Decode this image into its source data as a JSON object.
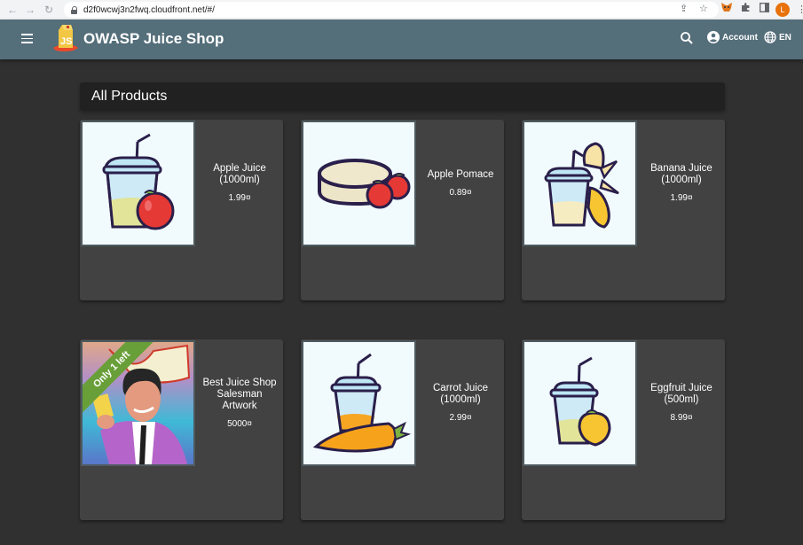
{
  "browser": {
    "url": "d2f0wcwj3n2fwq.cloudfront.net/#/",
    "profile_initial": "L",
    "icons": [
      "back-icon",
      "forward-icon",
      "reload-icon",
      "lock-icon",
      "share-icon",
      "star-icon",
      "metamask-extension-icon",
      "extensions-puzzle-icon",
      "sidepanel-icon",
      "profile-avatar",
      "more-menu-icon"
    ]
  },
  "toolbar": {
    "app_title": "OWASP Juice Shop",
    "account_label": "Account",
    "language_label": "EN",
    "color": "#546e7a"
  },
  "main": {
    "section_title": "All Products",
    "products": [
      {
        "name": "Apple Juice (1000ml)",
        "price": "1.99¤",
        "image": "apple-juice",
        "badge": null
      },
      {
        "name": "Apple Pomace",
        "price": "0.89¤",
        "image": "apple-pomace",
        "badge": null
      },
      {
        "name": "Banana Juice (1000ml)",
        "price": "1.99¤",
        "image": "banana-juice",
        "badge": null
      },
      {
        "name": "Best Juice Shop Salesman Artwork",
        "price": "5000¤",
        "image": "salesman-artwork",
        "badge": "Only 1 left"
      },
      {
        "name": "Carrot Juice (1000ml)",
        "price": "2.99¤",
        "image": "carrot-juice",
        "badge": null
      },
      {
        "name": "Eggfruit Juice (500ml)",
        "price": "8.99¤",
        "image": "eggfruit-juice",
        "badge": null
      }
    ]
  },
  "colors": {
    "background": "#303030",
    "card": "#424242",
    "badge": "#689f38"
  }
}
